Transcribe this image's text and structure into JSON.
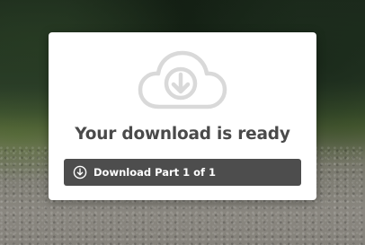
{
  "background": {
    "description_icon": "forest-gravel-photo"
  },
  "dialog": {
    "icon": "cloud-download-icon",
    "title": "Your download is ready",
    "button": {
      "label": "Download Part 1 of 1",
      "icon": "circle-download-icon",
      "color": "#4d4d4d",
      "text_color": "#ffffff"
    },
    "title_color": "#4a4a4a",
    "icon_color": "#d9d9d9"
  }
}
